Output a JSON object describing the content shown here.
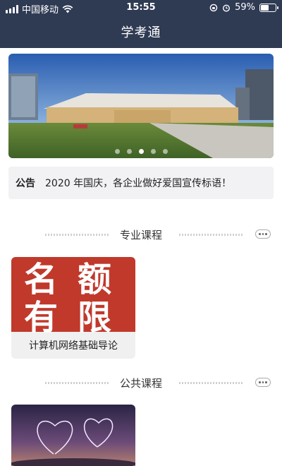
{
  "status_bar": {
    "carrier": "中国移动",
    "time": "15:55",
    "battery": "59%",
    "battery_level": 0.59
  },
  "app": {
    "title": "学考通"
  },
  "banner": {
    "slide_count": 5,
    "active_index": 2
  },
  "notice": {
    "tag": "公告",
    "text": "2020 年国庆，各企业做好爱国宣传标语！"
  },
  "sections": [
    {
      "title": "专业课程",
      "courses": [
        {
          "name": "计算机网络基础导论",
          "cover_text": [
            "名",
            "额",
            "有",
            "限"
          ]
        }
      ]
    },
    {
      "title": "公共课程",
      "courses": [
        {
          "name": ""
        }
      ]
    }
  ]
}
